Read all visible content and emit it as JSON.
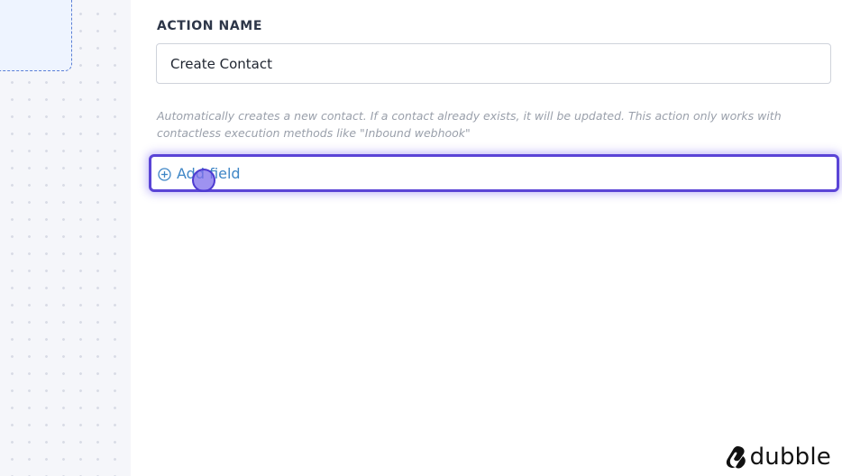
{
  "action": {
    "section_label": "ACTION NAME",
    "name_value": "Create Contact",
    "help_text": "Automatically creates a new contact. If a contact already exists, it will be updated. This action only works with contactless execution methods like \"Inbound webhook\""
  },
  "add_field": {
    "label": "Add field",
    "icon": "plus-circle-icon"
  },
  "branding": {
    "logo_text": "dubble",
    "logo_icon": "dubble-logo-icon"
  },
  "colors": {
    "focus_border": "#5a44d6",
    "link": "#3f86c6",
    "canvas_bg": "#f5f6fa"
  }
}
